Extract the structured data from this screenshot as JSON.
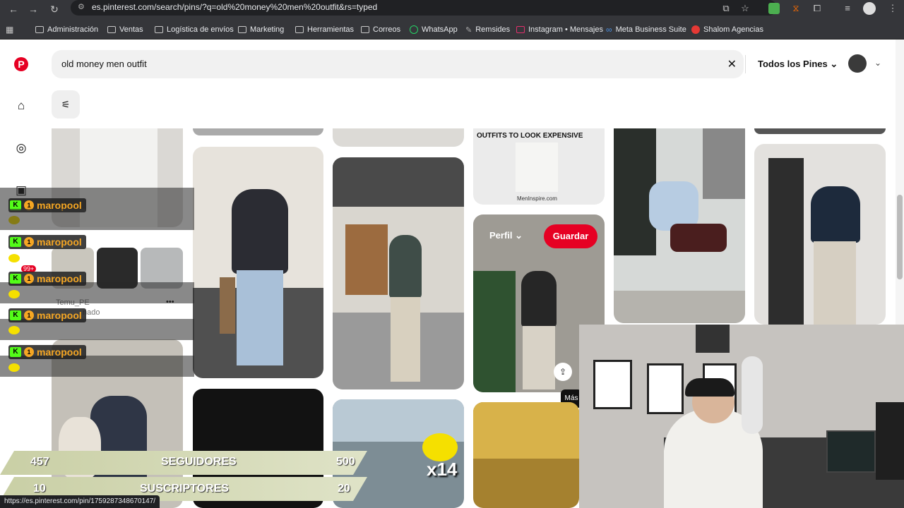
{
  "browser": {
    "url": "es.pinterest.com/search/pins/?q=old%20money%20men%20outfit&rs=typed",
    "bookmarks": [
      "Administración",
      "Ventas",
      "Logística de envíos",
      "Marketing",
      "Herramientas",
      "Correos",
      "WhatsApp",
      "Remsides",
      "Instagram • Mensajes",
      "Meta Business Suite",
      "Shalom Agencias"
    ],
    "status_url": "https://es.pinterest.com/pin/1759287348670147/"
  },
  "pinterest": {
    "search_value": "old money men outfit",
    "filter_label": "Todos los Pines",
    "pin_text": {
      "outfits_headline": "OUTFITS TO LOOK EXPENSIVE",
      "watermark": "MenInspire.com",
      "perfil_label": "Perfil",
      "save_label": "Guardar",
      "mas_label": "Más",
      "temu_title": "Temu_PE",
      "temu_sub": "nado",
      "dots": "•••"
    }
  },
  "overlay": {
    "chat_user": "maropool",
    "chat_rows": [
      "maropool",
      "maropool",
      "maropool",
      "maropool",
      "maropool"
    ],
    "badge_count": "99+",
    "combo": "x14",
    "seguidores_current": "457",
    "seguidores_label": "SEGUIDORES",
    "seguidores_goal": "500",
    "suscriptores_current": "10",
    "suscriptores_label": "SUSCRIPTORES",
    "suscriptores_goal": "20"
  },
  "colors": {
    "pinterest_red": "#e60023",
    "chrome_dark": "#35363a",
    "kick_green": "#53fc18",
    "username_orange": "#f5a623",
    "stats_bar": "#d7dcbc"
  }
}
